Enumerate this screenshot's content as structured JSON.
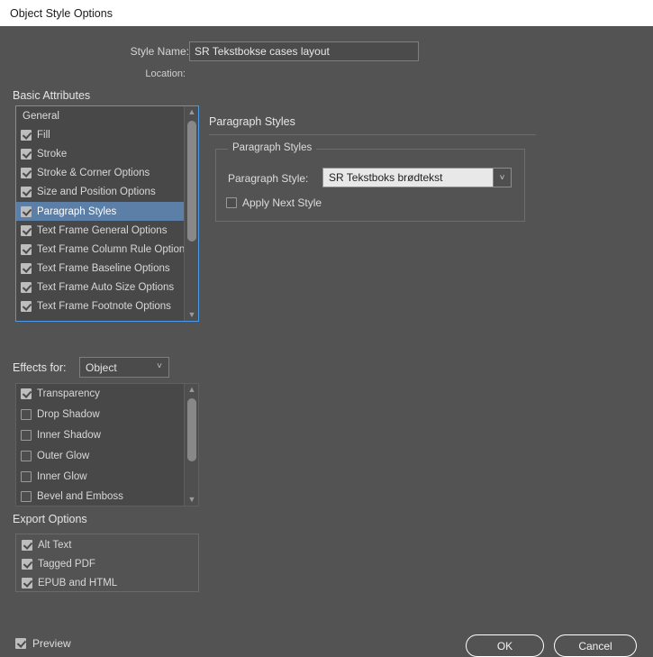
{
  "window": {
    "title": "Object Style Options"
  },
  "form": {
    "style_name_label": "Style Name:",
    "style_name_value": "SR Tekstbokse cases layout",
    "location_label": "Location:"
  },
  "basic_attributes": {
    "heading": "Basic Attributes",
    "items": [
      {
        "label": "General",
        "type": "header",
        "checked": null,
        "selected": false
      },
      {
        "label": "Fill",
        "type": "item",
        "checked": true,
        "selected": false
      },
      {
        "label": "Stroke",
        "type": "item",
        "checked": true,
        "selected": false
      },
      {
        "label": "Stroke & Corner Options",
        "type": "item",
        "checked": true,
        "selected": false
      },
      {
        "label": "Size and Position Options",
        "type": "item",
        "checked": true,
        "selected": false
      },
      {
        "label": "Paragraph Styles",
        "type": "item",
        "checked": true,
        "selected": true
      },
      {
        "label": "Text Frame General Options",
        "type": "item",
        "checked": true,
        "selected": false
      },
      {
        "label": "Text Frame Column Rule Options",
        "type": "item",
        "checked": true,
        "selected": false
      },
      {
        "label": "Text Frame Baseline Options",
        "type": "item",
        "checked": true,
        "selected": false
      },
      {
        "label": "Text Frame Auto Size Options",
        "type": "item",
        "checked": true,
        "selected": false
      },
      {
        "label": "Text Frame Footnote Options",
        "type": "item",
        "checked": true,
        "selected": false
      }
    ],
    "scroll_up_icon": "chevron-up-icon",
    "scroll_down_icon": "chevron-down-icon"
  },
  "effects": {
    "label": "Effects for:",
    "target_value": "Object",
    "items": [
      {
        "label": "Transparency",
        "checked": true
      },
      {
        "label": "Drop Shadow",
        "checked": false
      },
      {
        "label": "Inner Shadow",
        "checked": false
      },
      {
        "label": "Outer Glow",
        "checked": false
      },
      {
        "label": "Inner Glow",
        "checked": false
      },
      {
        "label": "Bevel and Emboss",
        "checked": false
      }
    ]
  },
  "export_options": {
    "heading": "Export Options",
    "items": [
      {
        "label": "Alt Text",
        "checked": true
      },
      {
        "label": "Tagged PDF",
        "checked": true
      },
      {
        "label": "EPUB and HTML",
        "checked": true
      }
    ]
  },
  "right_pane": {
    "heading": "Paragraph Styles",
    "group_legend": "Paragraph Styles",
    "paragraph_style_label": "Paragraph Style:",
    "paragraph_style_value": "SR Tekstboks brødtekst",
    "apply_next_style_label": "Apply Next Style",
    "apply_next_style_checked": false
  },
  "footer": {
    "preview_label": "Preview",
    "preview_checked": true,
    "ok_label": "OK",
    "cancel_label": "Cancel"
  },
  "colors": {
    "dialog_bg": "#535353",
    "titlebar_bg": "#ffffff",
    "list_bg": "#484848",
    "focus_border": "#4a9ae8",
    "selection_bg": "#5b7fa6",
    "dropdown_light_bg": "#e8e8e8",
    "text": "#d4d4d4"
  }
}
